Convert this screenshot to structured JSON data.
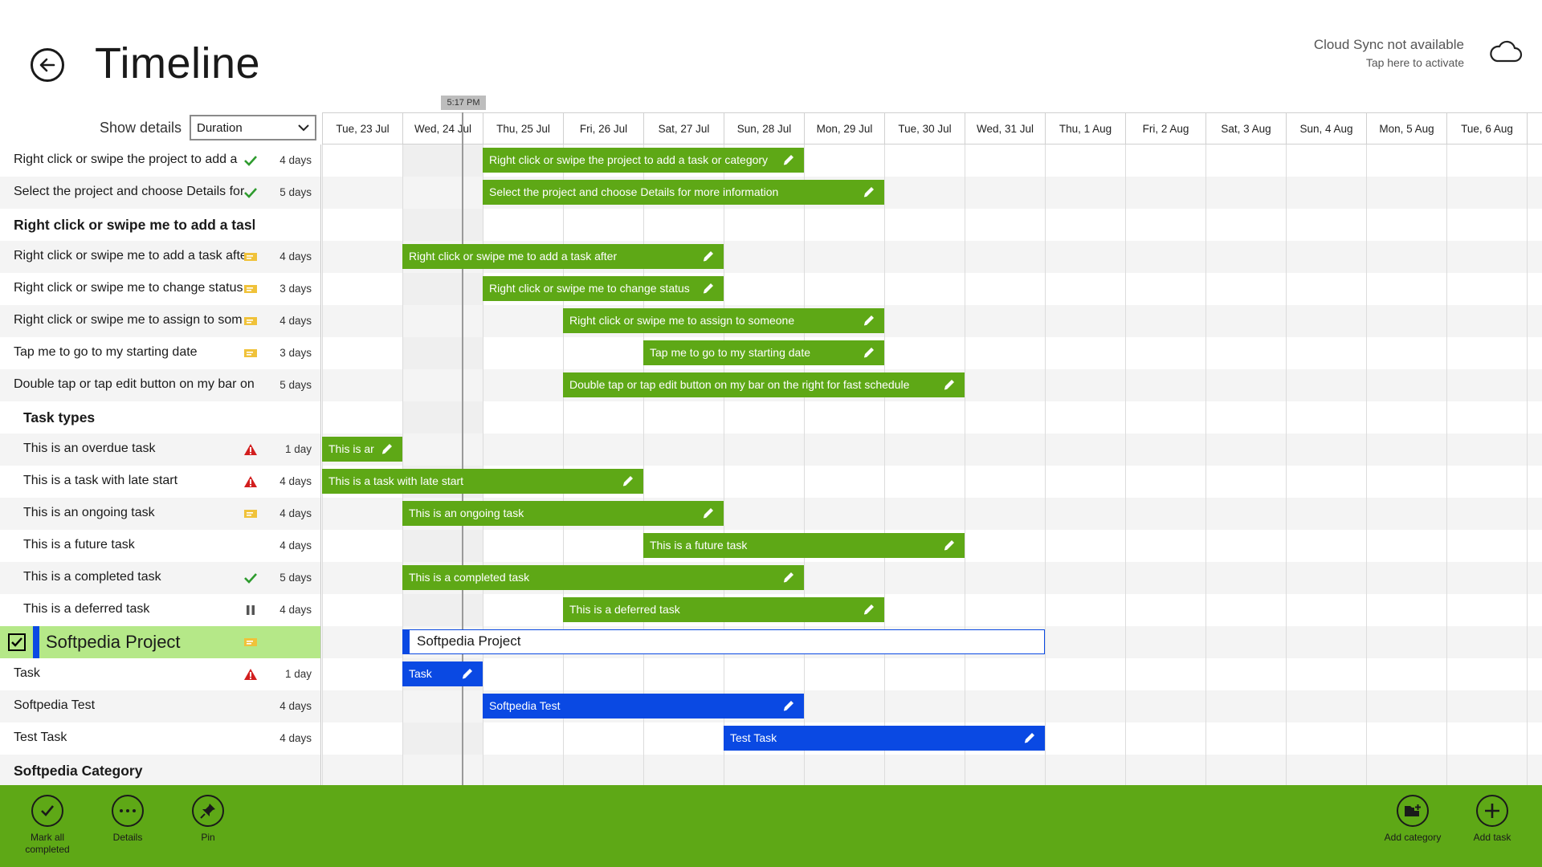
{
  "header": {
    "title": "Timeline",
    "sync_line1": "Cloud Sync not available",
    "sync_line2": "Tap here to activate"
  },
  "controls": {
    "show_details_label": "Show details",
    "duration_value": "Duration"
  },
  "now_marker": "5:17 PM",
  "dates": [
    "Tue, 23 Jul",
    "Wed, 24 Jul",
    "Thu, 25 Jul",
    "Fri, 26 Jul",
    "Sat, 27 Jul",
    "Sun, 28 Jul",
    "Mon, 29 Jul",
    "Tue, 30 Jul",
    "Wed, 31 Jul",
    "Thu, 1 Aug",
    "Fri, 2 Aug",
    "Sat, 3 Aug",
    "Sun, 4 Aug",
    "Mon, 5 Aug",
    "Tue, 6 Aug",
    "W"
  ],
  "rows": [
    {
      "name": "Right click or swipe the project to add a",
      "status": "check",
      "duration": "4 days",
      "kind": "task",
      "bar": {
        "label": "Right click or swipe the project to add a task or category",
        "start": 2,
        "span": 4,
        "color": "green"
      }
    },
    {
      "name": "Select the project and choose Details for",
      "status": "check",
      "duration": "5 days",
      "kind": "task",
      "bar": {
        "label": "Select the project and choose Details for more information",
        "start": 2,
        "span": 5,
        "color": "green"
      }
    },
    {
      "name": "Right click or swipe me to add a task",
      "status": "",
      "duration": "",
      "kind": "section"
    },
    {
      "name": "Right click or swipe me to add a task afte",
      "status": "ongoing",
      "duration": "4 days",
      "kind": "task",
      "bar": {
        "label": "Right click or swipe me to add a task after",
        "start": 1,
        "span": 4,
        "color": "green"
      }
    },
    {
      "name": "Right click or swipe me to change status",
      "status": "ongoing",
      "duration": "3 days",
      "kind": "task",
      "bar": {
        "label": "Right click or swipe me to change status",
        "start": 2,
        "span": 3,
        "color": "green"
      }
    },
    {
      "name": "Right click or swipe me to assign to som",
      "status": "ongoing",
      "duration": "4 days",
      "kind": "task",
      "bar": {
        "label": "Right click or swipe me to assign to someone",
        "start": 3,
        "span": 4,
        "color": "green"
      }
    },
    {
      "name": "Tap me to go to my starting date",
      "status": "ongoing",
      "duration": "3 days",
      "kind": "task",
      "bar": {
        "label": "Tap me to go to my starting date",
        "start": 4,
        "span": 3,
        "color": "green"
      }
    },
    {
      "name": "Double tap or tap edit button on my bar on t",
      "status": "",
      "duration": "5 days",
      "kind": "task",
      "bar": {
        "label": "Double tap or tap edit button on my bar on the right for fast schedule",
        "start": 3,
        "span": 5,
        "color": "green"
      }
    },
    {
      "name": "Task types",
      "status": "",
      "duration": "",
      "kind": "subsection"
    },
    {
      "name": "This is an overdue task",
      "status": "warning",
      "duration": "1 day",
      "kind": "subtask",
      "bar": {
        "label": "This is ar",
        "start": 0,
        "span": 1,
        "color": "green"
      }
    },
    {
      "name": "This is a task with late start",
      "status": "warning",
      "duration": "4 days",
      "kind": "subtask",
      "bar": {
        "label": "This is a task with late start",
        "start": 0,
        "span": 4,
        "color": "green"
      }
    },
    {
      "name": "This is an ongoing task",
      "status": "ongoing",
      "duration": "4 days",
      "kind": "subtask",
      "bar": {
        "label": "This is an ongoing task",
        "start": 1,
        "span": 4,
        "color": "green"
      }
    },
    {
      "name": "This is a future task",
      "status": "",
      "duration": "4 days",
      "kind": "subtask",
      "bar": {
        "label": "This is a future task",
        "start": 4,
        "span": 4,
        "color": "green"
      }
    },
    {
      "name": "This is a completed task",
      "status": "check",
      "duration": "5 days",
      "kind": "subtask",
      "bar": {
        "label": "This is a completed task",
        "start": 1,
        "span": 5,
        "color": "green"
      }
    },
    {
      "name": "This is a deferred task",
      "status": "pause",
      "duration": "4 days",
      "kind": "subtask",
      "bar": {
        "label": "This is a deferred task",
        "start": 3,
        "span": 4,
        "color": "green"
      }
    },
    {
      "name": "Softpedia Project",
      "status": "ongoing",
      "duration": "",
      "kind": "project",
      "bar": {
        "label": "Softpedia Project",
        "start": 1,
        "span": 8,
        "color": "outline"
      }
    },
    {
      "name": "Task",
      "status": "warning",
      "duration": "1 day",
      "kind": "task",
      "bar": {
        "label": "Task",
        "start": 1,
        "span": 1,
        "color": "blue"
      }
    },
    {
      "name": "Softpedia Test",
      "status": "",
      "duration": "4 days",
      "kind": "task",
      "bar": {
        "label": "Softpedia Test",
        "start": 2,
        "span": 4,
        "color": "blue"
      }
    },
    {
      "name": "Test Task",
      "status": "",
      "duration": "4 days",
      "kind": "task",
      "bar": {
        "label": "Test Task",
        "start": 5,
        "span": 4,
        "color": "blue"
      }
    },
    {
      "name": "Softpedia Category",
      "status": "",
      "duration": "",
      "kind": "section"
    }
  ],
  "appbar": {
    "mark_all_completed": "Mark all completed",
    "details": "Details",
    "pin": "Pin",
    "add_category": "Add category",
    "add_task": "Add task"
  },
  "colors": {
    "accent_green": "#5ea816",
    "project_blue": "#0a49e3",
    "project_highlight": "#b5e888",
    "status_check": "#2e9b2e",
    "status_warning": "#d21e1e",
    "status_ongoing": "#f0c23a"
  }
}
